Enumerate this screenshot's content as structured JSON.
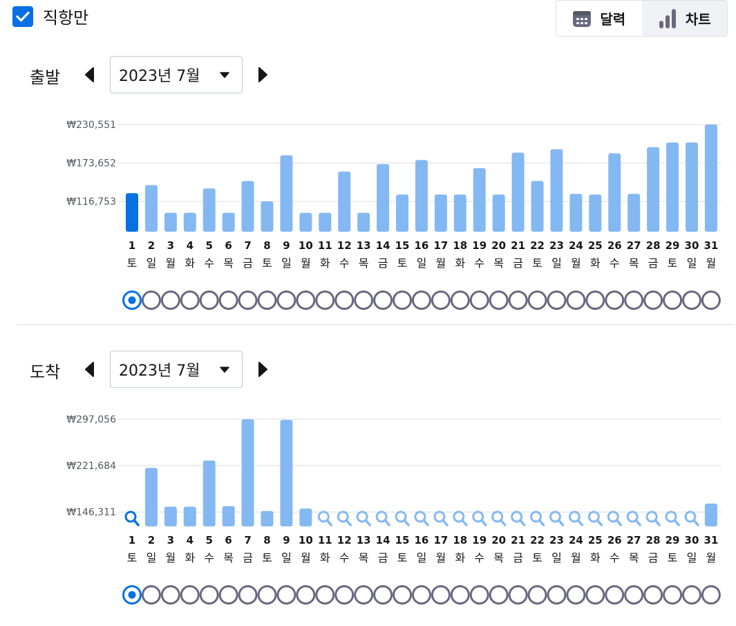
{
  "filter": {
    "direct_only_label": "직항만",
    "direct_only_checked": true
  },
  "view_toggle": {
    "calendar_label": "달력",
    "chart_label": "차트",
    "active": "chart"
  },
  "colors": {
    "accent": "#0770e3",
    "bar": "#84b8f2",
    "bar_selected": "#0770e3",
    "grid": "#dddde5",
    "dot_border": "#68697f",
    "text_dark": "#161616",
    "text_muted": "#545860"
  },
  "departure": {
    "title": "출발",
    "month_label": "2023년 7월",
    "selected_day": 1,
    "y_ticks": [
      "₩230,551",
      "₩173,652",
      "₩116,753"
    ],
    "chart_data": {
      "type": "bar",
      "categories": [
        "1",
        "2",
        "3",
        "4",
        "5",
        "6",
        "7",
        "8",
        "9",
        "10",
        "11",
        "12",
        "13",
        "14",
        "15",
        "16",
        "17",
        "18",
        "19",
        "20",
        "21",
        "22",
        "23",
        "24",
        "25",
        "26",
        "27",
        "28",
        "29",
        "30",
        "31"
      ],
      "weekdays": [
        "토",
        "일",
        "월",
        "화",
        "수",
        "목",
        "금",
        "토",
        "일",
        "월",
        "화",
        "수",
        "목",
        "금",
        "토",
        "일",
        "월",
        "화",
        "수",
        "목",
        "금",
        "토",
        "일",
        "월",
        "화",
        "수",
        "목",
        "금",
        "토",
        "일",
        "월"
      ],
      "values": [
        129000,
        141000,
        100000,
        100000,
        136000,
        100000,
        147000,
        117000,
        185000,
        100000,
        100000,
        161000,
        100000,
        172000,
        127000,
        178000,
        127000,
        127000,
        166000,
        127000,
        189000,
        147000,
        194000,
        128000,
        127000,
        188000,
        128000,
        197000,
        204000,
        204000,
        230551
      ],
      "ylim": [
        72000,
        230551
      ],
      "ticks": [
        230551,
        173652,
        116753
      ]
    }
  },
  "arrival": {
    "title": "도착",
    "month_label": "2023년 7월",
    "selected_day": 1,
    "y_ticks": [
      "₩297,056",
      "₩221,684",
      "₩146,311"
    ],
    "chart_data": {
      "type": "bar",
      "categories": [
        "1",
        "2",
        "3",
        "4",
        "5",
        "6",
        "7",
        "8",
        "9",
        "10",
        "11",
        "12",
        "13",
        "14",
        "15",
        "16",
        "17",
        "18",
        "19",
        "20",
        "21",
        "22",
        "23",
        "24",
        "25",
        "26",
        "27",
        "28",
        "29",
        "30",
        "31"
      ],
      "weekdays": [
        "토",
        "일",
        "월",
        "화",
        "수",
        "목",
        "금",
        "토",
        "일",
        "월",
        "화",
        "수",
        "목",
        "금",
        "토",
        "일",
        "월",
        "화",
        "수",
        "목",
        "금",
        "토",
        "일",
        "월",
        "화",
        "수",
        "목",
        "금",
        "토",
        "일",
        "월"
      ],
      "values": [
        null,
        218000,
        155000,
        155000,
        230000,
        156000,
        297056,
        148000,
        296000,
        152000,
        null,
        null,
        null,
        null,
        null,
        null,
        null,
        null,
        null,
        null,
        null,
        null,
        null,
        null,
        null,
        null,
        null,
        null,
        null,
        null,
        160000
      ],
      "ylim": [
        123000,
        297056
      ],
      "ticks": [
        297056,
        221684,
        146311
      ]
    }
  }
}
